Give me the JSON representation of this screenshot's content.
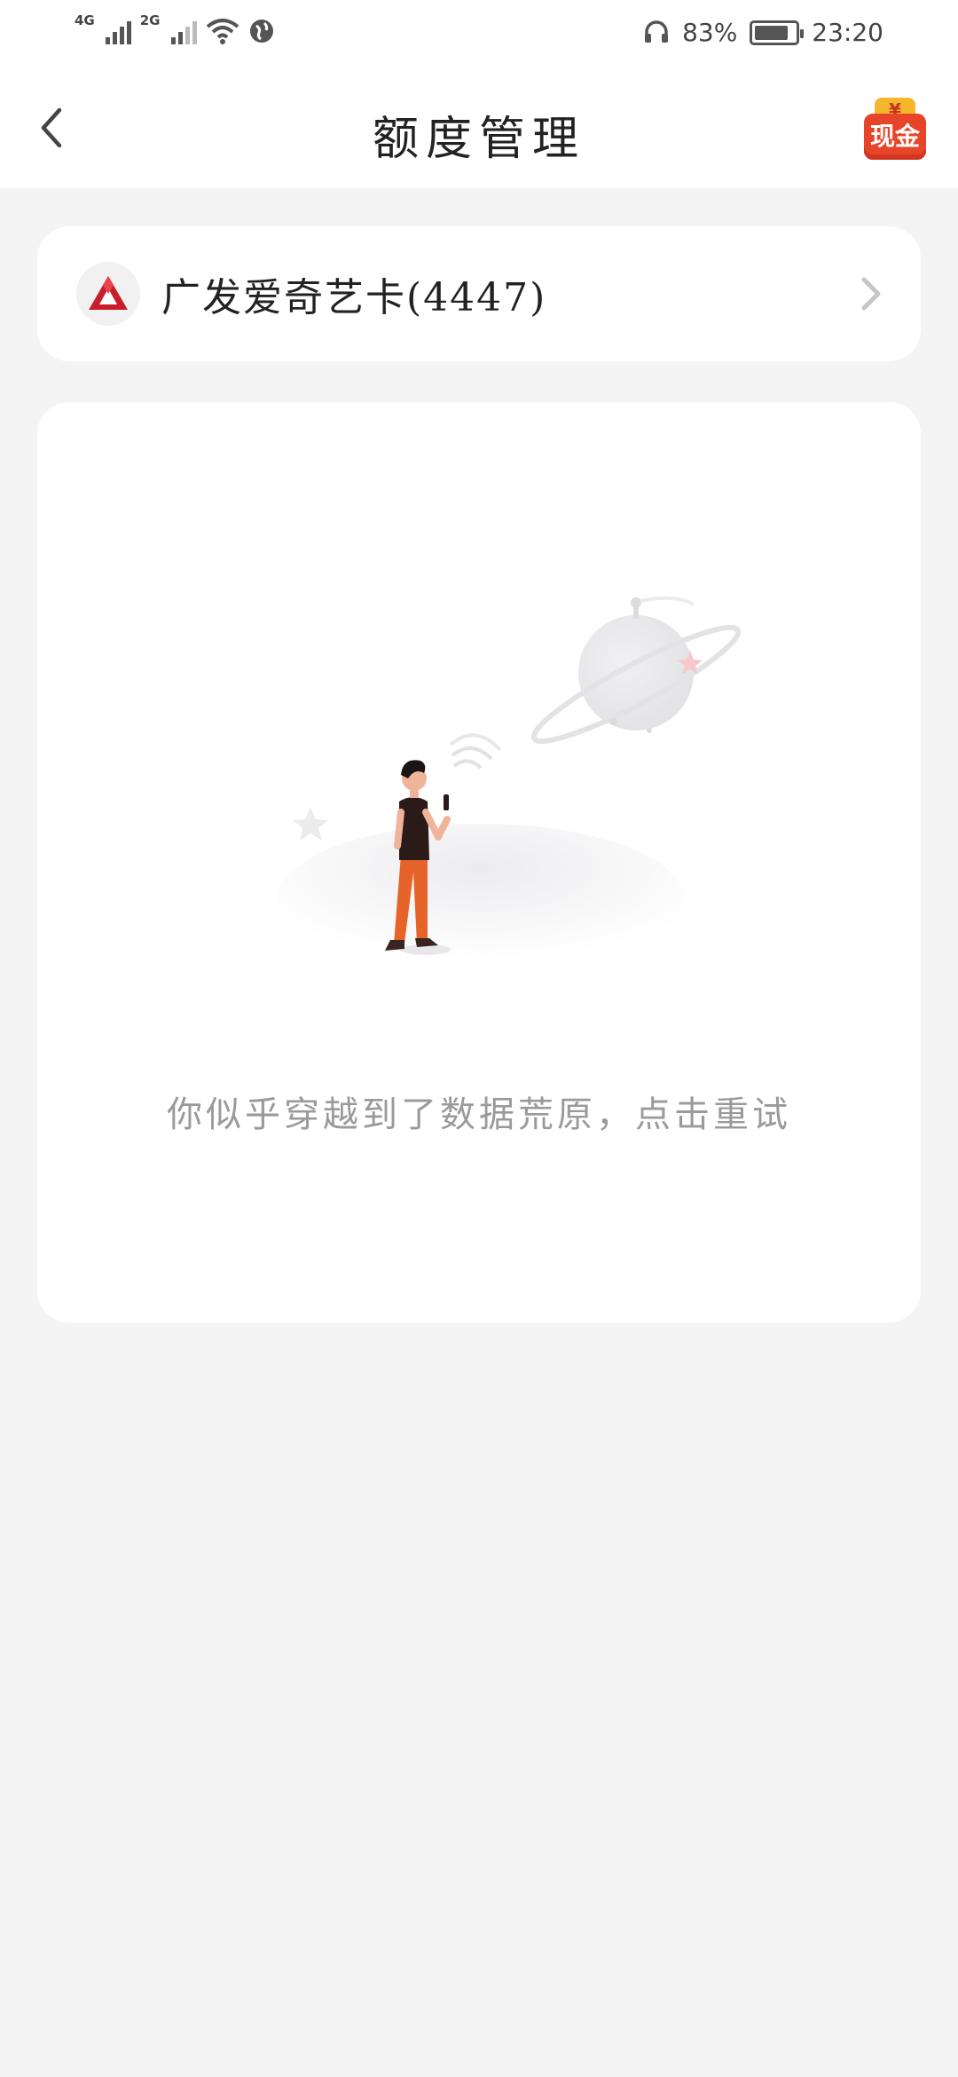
{
  "status_bar": {
    "sim1": "4G",
    "sim2": "2G",
    "battery_text": "83%",
    "battery_level": 0.83,
    "time": "23:20"
  },
  "header": {
    "title": "额度管理",
    "cash_badge_symbol": "¥",
    "cash_badge_label": "现金"
  },
  "card": {
    "name": "广发爱奇艺卡(4447)"
  },
  "empty_state": {
    "message": "你似乎穿越到了数据荒原，点击重试"
  },
  "colors": {
    "accent": "#e6452a",
    "figure_pants": "#e6642a",
    "logo_red": "#c81e2a"
  }
}
